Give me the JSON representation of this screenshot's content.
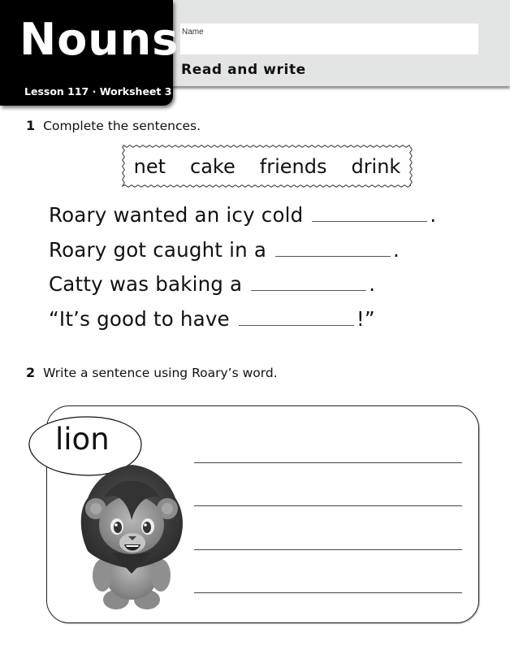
{
  "header": {
    "title": "Nouns",
    "lesson": "Lesson 117 · Worksheet 3",
    "name_label": "Name",
    "name_value": "",
    "section_title": "Read and write"
  },
  "question1": {
    "number": "1",
    "instruction": "Complete the sentences.",
    "word_bank": [
      "net",
      "cake",
      "friends",
      "drink"
    ],
    "sentences": [
      {
        "before": "Roary wanted an icy cold",
        "after": "."
      },
      {
        "before": "Roary got caught in a",
        "after": "."
      },
      {
        "before": "Catty was baking a",
        "after": "."
      },
      {
        "before": "“It’s good to have",
        "after": "!”"
      }
    ]
  },
  "question2": {
    "number": "2",
    "instruction": "Write a sentence using Roary’s word.",
    "speech_word": "lion",
    "character": "lion-cub-character",
    "writing_lines": 4
  }
}
